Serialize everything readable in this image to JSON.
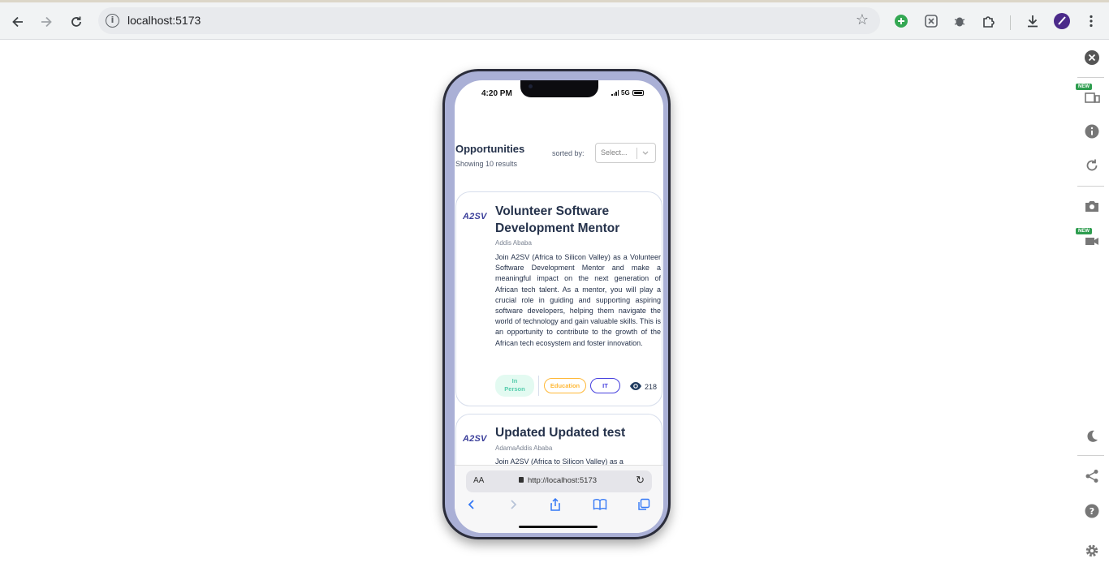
{
  "browser": {
    "url": "localhost:5173"
  },
  "side_toolbar": {
    "new_badge": "NEW"
  },
  "phone": {
    "status_time": "4:20 PM",
    "network": "5G"
  },
  "page": {
    "title": "Opportunities",
    "results": "Showing 10 results",
    "sort_label": "sorted by:",
    "select_placeholder": "Select..."
  },
  "cards": [
    {
      "logo": "A2SV",
      "title": "Volunteer Software Development Mentor",
      "location": "Addis Ababa",
      "description": "Join A2SV (Africa to Silicon Valley) as a Volunteer Software Development Mentor and make a meaningful impact on the next generation of African tech talent. As a mentor, you will play a crucial role in guiding and supporting aspiring software developers, helping them navigate the world of technology and gain valuable skills. This is an opportunity to contribute to the growth of the African tech ecosystem and foster innovation.",
      "tags": [
        "In Person",
        "Education",
        "IT"
      ],
      "views": "218",
      "colors": {
        "in_person": "#56CDAD",
        "education": "#FFB836",
        "it": "#4640DE"
      }
    },
    {
      "logo": "A2SV",
      "title": "Updated Updated test",
      "location": "AdamaAddis Ababa",
      "description": "Join A2SV (Africa to Silicon Valley) as a"
    }
  ],
  "safari": {
    "aa_label": "AA",
    "url": "http://localhost:5173"
  }
}
